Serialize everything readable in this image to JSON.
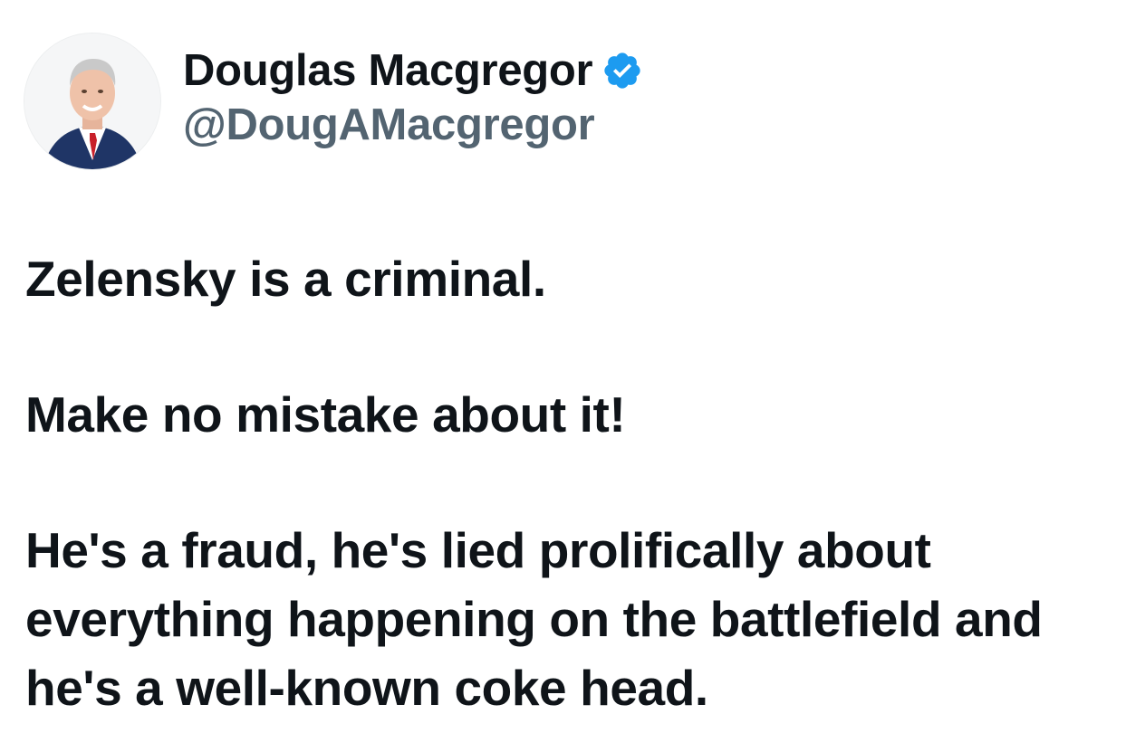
{
  "author": {
    "display_name": "Douglas Macgregor",
    "handle": "@DougAMacgregor",
    "verified": true,
    "verified_color": "#1d9bf0",
    "avatar_icon": "profile-photo"
  },
  "tweet": {
    "paragraphs": [
      "Zelensky is a criminal.",
      "Make no mistake about it!",
      "He's a fraud, he's lied prolifically about everything happening on the battlefield and he's a well-known coke head."
    ]
  },
  "colors": {
    "text": "#0f1419",
    "handle": "#536471",
    "background": "#ffffff"
  }
}
